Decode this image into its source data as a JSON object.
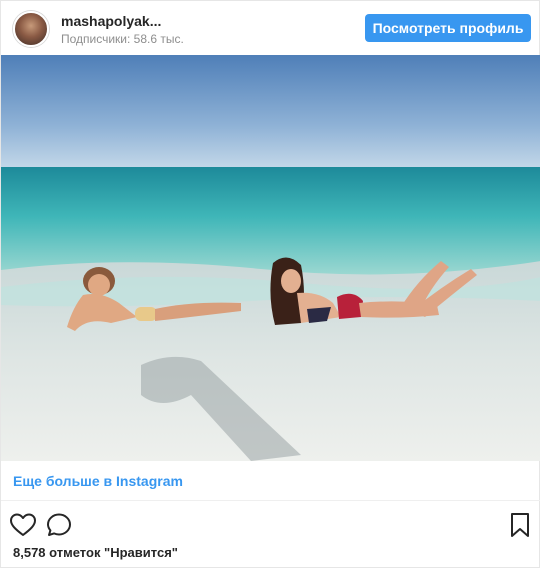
{
  "header": {
    "username": "mashapolyak...",
    "followers": "Подписчики: 58.6 тыс.",
    "view_profile_label": "Посмотреть профиль"
  },
  "post": {
    "more_link": "Еще больше в Instagram",
    "likes_text": "8,578 отметок \"Нравится\""
  },
  "icons": {
    "like": "heart-icon",
    "comment": "comment-icon",
    "save": "bookmark-icon"
  },
  "colors": {
    "brand_blue": "#3897f0",
    "text": "#262626",
    "muted": "#8e8e8e"
  }
}
